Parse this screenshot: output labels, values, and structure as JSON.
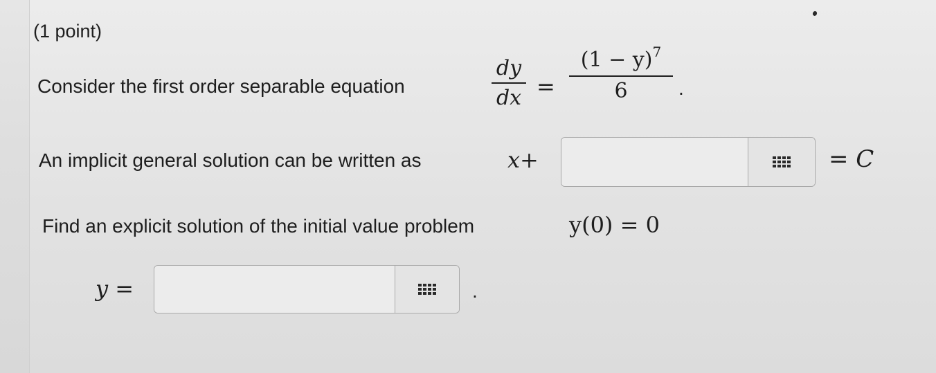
{
  "problem": {
    "points_label": "(1 point)",
    "line1": {
      "text": "Consider the first order separable equation",
      "lhs_num": "dy",
      "lhs_den": "dx",
      "equals": "=",
      "rhs_num": "(1 − y)",
      "rhs_exp": "7",
      "rhs_den": "6",
      "period": "."
    },
    "line2": {
      "text": "An implicit general solution can be written as",
      "x_plus": "x+",
      "answer_value": "",
      "equals_c": "= C"
    },
    "line3": {
      "text": "Find an explicit solution of the initial value problem",
      "condition": "y(0) = 0"
    },
    "line4": {
      "y_equals": "y =",
      "answer_value": "",
      "period": "."
    }
  },
  "icons": {
    "matrix_button_icon": "grid-icon"
  }
}
